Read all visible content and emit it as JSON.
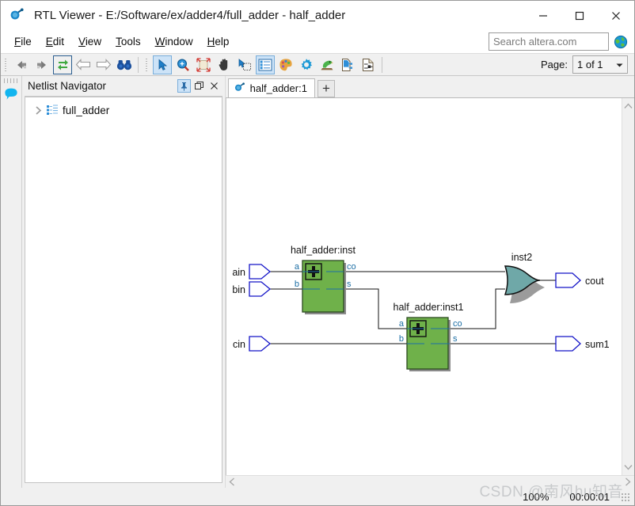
{
  "window": {
    "title": "RTL Viewer - E:/Software/ex/adder4/full_adder - half_adder",
    "app_icon": "rtl-viewer-icon",
    "controls": {
      "minimize": "minimize-icon",
      "maximize": "maximize-icon",
      "close": "close-icon"
    }
  },
  "menubar": {
    "items": [
      {
        "mnemonic": "F",
        "rest": "ile"
      },
      {
        "mnemonic": "E",
        "rest": "dit"
      },
      {
        "mnemonic": "V",
        "rest": "iew"
      },
      {
        "mnemonic": "T",
        "rest": "ools"
      },
      {
        "mnemonic": "W",
        "rest": "indow"
      },
      {
        "mnemonic": "H",
        "rest": "elp"
      }
    ],
    "search": {
      "placeholder": "Search altera.com",
      "value": "",
      "icon": "globe-icon"
    }
  },
  "toolbar": {
    "buttons": [
      {
        "name": "back-icon",
        "state": "disabled"
      },
      {
        "name": "forward-icon",
        "state": "disabled"
      },
      {
        "name": "refresh-icon",
        "state": "framed"
      },
      {
        "name": "previous-page-icon",
        "state": "disabled"
      },
      {
        "name": "next-page-icon",
        "state": "disabled"
      },
      {
        "name": "find-icon",
        "state": "enabled"
      },
      {
        "name": "select-tool-icon",
        "state": "selected"
      },
      {
        "name": "zoom-tool-icon",
        "state": "enabled"
      },
      {
        "name": "fit-in-window-icon",
        "state": "enabled"
      },
      {
        "name": "hand-tool-icon",
        "state": "enabled"
      },
      {
        "name": "area-select-icon",
        "state": "enabled"
      },
      {
        "name": "hierarchy-list-icon",
        "state": "selected"
      },
      {
        "name": "color-palette-icon",
        "state": "enabled"
      },
      {
        "name": "settings-gear-icon",
        "state": "enabled"
      },
      {
        "name": "bird-icon",
        "state": "enabled"
      },
      {
        "name": "export-netlist-icon",
        "state": "enabled"
      },
      {
        "name": "export-schematic-icon",
        "state": "enabled"
      }
    ],
    "page_label": "Page:",
    "page_value": "1 of 1"
  },
  "navigator": {
    "title": "Netlist Navigator",
    "buttons": [
      {
        "name": "pin-panel-button",
        "glyph": "pin-icon"
      },
      {
        "name": "restore-panel-button",
        "glyph": "restore-icon"
      },
      {
        "name": "close-panel-button",
        "glyph": "close-icon"
      }
    ],
    "tree": [
      {
        "label": "full_adder",
        "expanded": false,
        "icon": "hierarchy-node-icon"
      }
    ]
  },
  "leftdock": {
    "items": [
      {
        "name": "messages-panel-icon"
      }
    ]
  },
  "tabs": {
    "items": [
      {
        "label": "half_adder:1",
        "icon": "rtl-viewer-icon",
        "active": true
      }
    ],
    "new_tab_label": "+"
  },
  "schematic": {
    "blocks": [
      {
        "id": "inst",
        "label": "half_adder:inst",
        "symbol": "adder-plus-icon",
        "inputs": [
          "a",
          "b"
        ],
        "outputs": [
          "co",
          "s"
        ]
      },
      {
        "id": "inst1",
        "label": "half_adder:inst1",
        "symbol": "adder-plus-icon",
        "inputs": [
          "a",
          "b"
        ],
        "outputs": [
          "co",
          "s"
        ]
      }
    ],
    "gates": [
      {
        "id": "inst2",
        "label": "inst2",
        "type": "or-gate"
      }
    ],
    "input_ports": [
      {
        "label": "ain"
      },
      {
        "label": "bin"
      },
      {
        "label": "cin"
      }
    ],
    "output_ports": [
      {
        "label": "cout"
      },
      {
        "label": "sum1"
      }
    ]
  },
  "statusbar": {
    "zoom": "100%",
    "time": "00:00:01",
    "watermark": "CSDN @南风hu知音"
  }
}
